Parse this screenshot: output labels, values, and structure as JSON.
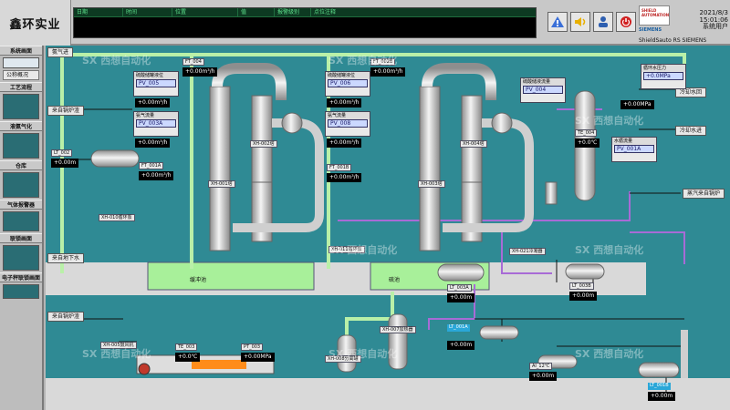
{
  "header": {
    "brand": "鑫环实业",
    "alarm_columns": [
      "日期",
      "时间",
      "位置",
      "值",
      "报警级别",
      "点位注释"
    ],
    "datetime": "2021/8/3 15:01:06",
    "user": "系统用户",
    "device_tag": "ShieldSauto RS SIEMENS",
    "logo_text": "SHIELD AUTOMATION",
    "siemens": "SIEMENS"
  },
  "sidebar": {
    "sections": [
      "系统画面",
      "工艺流程",
      "液氨气化",
      "仓库",
      "气体报警器",
      "联锁画面",
      "电子秤联锁画面"
    ],
    "overview_item": "公称概况"
  },
  "flows": {
    "ammonia_in": "氨气进",
    "slag_in_top": "来自锅炉渣",
    "slag_in_bottom": "来自锅炉渣",
    "cooling_water_out": "冷却水回",
    "cooling_water_in": "冷却水进",
    "steam_in": "蒸汽来自锅炉",
    "site_water": "来自地下水"
  },
  "panels": {
    "p1": {
      "title": "硫酸储罐液位",
      "tag": "PV_005",
      "val": "+0.00m³/h"
    },
    "p2": {
      "title": "氨气流量",
      "tag": "PV_003A",
      "val": "+0.00m³/h"
    },
    "p3": {
      "title": "硫酸储罐液位",
      "tag": "PV_006",
      "val": "+0.00m³/h"
    },
    "p4": {
      "title": "氨气流量",
      "tag": "PV_008",
      "val": "+0.00m³/h"
    },
    "p5": {
      "title": "硫酸储液流量",
      "tag": "PV_004",
      "val": "+0.00m³/h"
    },
    "p6": {
      "title": "水循流量",
      "tag": "PV_001A",
      "val": "+0.00m³/h"
    },
    "p7": {
      "title": "循环水压力",
      "tag": "PT_007",
      "val": "+0.0MPa"
    }
  },
  "readouts": {
    "lt002": {
      "tag": "LT_002",
      "val": "+0.00m"
    },
    "fi003": {
      "tag": "FT_004",
      "val": "+0.00m³/h"
    },
    "fi003b": {
      "tag": "FT_001A",
      "val": "+0.00m³/h"
    },
    "fi004": {
      "tag": "FT_002B",
      "val": "+0.00m³/h"
    },
    "fi005": {
      "tag": "FT_001B",
      "val": "+0.00m³/h"
    },
    "te004": {
      "tag": "TE_004",
      "val": "+0.0℃"
    },
    "pt005": {
      "tag": "PT_005",
      "val": "+0.00MPa"
    },
    "lt003a": {
      "tag": "LT_003A",
      "val": "+0.00m"
    },
    "lt003b": {
      "tag": "LT_003B",
      "val": "+0.00m"
    },
    "te003": {
      "tag": "TE_003",
      "val": "+0.0℃"
    },
    "pt003": {
      "tag": "PT_003",
      "val": "+0.00MPa"
    },
    "lt001a": {
      "tag": "LT_001A",
      "val": "+0.00m"
    },
    "lt001b": {
      "tag": "LT_001B",
      "val": "+0.00m"
    },
    "ai001": {
      "tag": "AI_12℃",
      "val": "+0.00m"
    }
  },
  "equipment": {
    "tower1": "XH-001塔",
    "tower2": "XH-002塔",
    "tower3": "XH-003塔",
    "tower4": "XH-004塔",
    "pool_a": "缓冲池",
    "pool_b": "硫池",
    "pump_a": "XH-010循环泵",
    "pump_b": "XH-011循环泵",
    "heater": "XH-007加热器",
    "vessel_a": "XH-021冷凝器",
    "vessel_b": "XH-022储罐",
    "tank_a": "XH-023罐",
    "tank_b": "XH-024罐",
    "separator": "XH-008分离罐",
    "reactor": "XH-009反应罐",
    "blower": "XH-005鼓风机"
  },
  "watermark": "SX 西想自动化",
  "colors": {
    "background": "#2f8a94",
    "pipe_green": "#b9f0a8",
    "pipe_purple": "#a86bd6",
    "pipe_steel": "#d8d8d8",
    "ground": "#d9d9d9"
  }
}
